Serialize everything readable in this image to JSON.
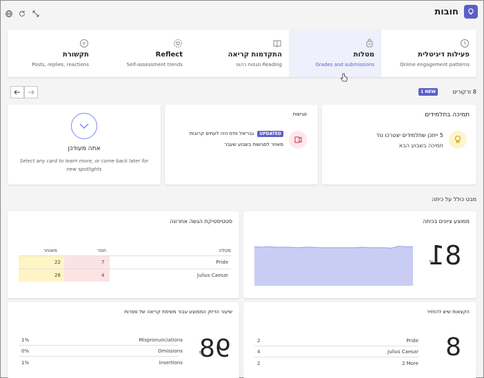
{
  "header": {
    "title": "חובות",
    "icons": [
      "lightbulb-icon",
      "expand-icon",
      "refresh-icon",
      "globe-icon"
    ]
  },
  "tabs": [
    {
      "title": "פעילות דיגיטלית",
      "subtitle": "Online engagement patterns",
      "icon": "clock-icon"
    },
    {
      "title": "מטלות",
      "subtitle": "Grades and submissions",
      "icon": "backpack-icon"
    },
    {
      "title": "התקדמות קריאה",
      "subtitle": "Reading מגמות רהוט",
      "icon": "book-icon"
    },
    {
      "title": "Reflect",
      "subtitle": "Self-assessment trends",
      "icon": "heart-icon"
    },
    {
      "title": "תקשורת",
      "subtitle": "Posts, replies, reactions",
      "icon": "chat-icon"
    }
  ],
  "spotlight": {
    "count_label": "8 זרקורים",
    "new_badge": "1 NEW"
  },
  "cards": {
    "support": {
      "title": "תמיכה בתלמידים",
      "body_line1": "5 ייתכן שתלמידים יצטרכו נוד",
      "body_line2": "תמיכה בשבוע הבא"
    },
    "meetings": {
      "title": "פגישות",
      "updated_badge": "UPDATED",
      "body_line1": "גבריאל וודס היה לעתים קרובות",
      "body_line2": "מאחר לפגישות בשבוע שעבר"
    },
    "uptodate": {
      "title": "אתה מעודכן",
      "body": "Select any card to learn more, or come back later for new spotlights"
    }
  },
  "overview": {
    "section_title": "מבט כולל על כיתה",
    "avg_grade": {
      "title": "ממוצע ציונים בכיתה",
      "value": "81",
      "unit": "%"
    },
    "submissions": {
      "title": "סטטיסטיקת הגשה אחרונה",
      "headers": {
        "assignment": "מטלה",
        "missing": "חסר",
        "late": "מאוחר"
      },
      "rows": [
        {
          "name": "Pride",
          "missing": "7",
          "late": "22"
        },
        {
          "name": "Julius Caesar",
          "missing": "4",
          "late": "26"
        }
      ]
    },
    "dues": {
      "title": "הקצאות שיש להחזיר",
      "value": "8",
      "rows": [
        {
          "name": "Pride",
          "count": "2"
        },
        {
          "name": "Julius Caesar",
          "count": "4"
        },
        {
          "name": "2 More",
          "count": "2"
        }
      ]
    },
    "accuracy": {
      "title": "שיעור הדיוק הממוצע עבור משימת קריאה של ספרות",
      "value": "98",
      "unit": "%",
      "rows": [
        {
          "name": "Mispronunciations",
          "value": "1%"
        },
        {
          "name": "Omissions",
          "value": "0%"
        },
        {
          "name": "Insertions",
          "value": "1%"
        }
      ]
    }
  },
  "chart_data": {
    "type": "area",
    "x": [
      1,
      2,
      3,
      4,
      5,
      6,
      7,
      8,
      9,
      10,
      11,
      12,
      13,
      14,
      15,
      16,
      17,
      18,
      19,
      20,
      21,
      22,
      23
    ],
    "values": [
      81,
      80,
      81,
      80,
      80,
      80,
      79,
      80,
      80,
      79,
      79,
      79,
      79,
      79,
      79,
      80,
      79,
      79,
      79,
      78,
      82,
      81,
      81
    ],
    "ylim": [
      0,
      100
    ],
    "color": "#c9cdf4"
  }
}
